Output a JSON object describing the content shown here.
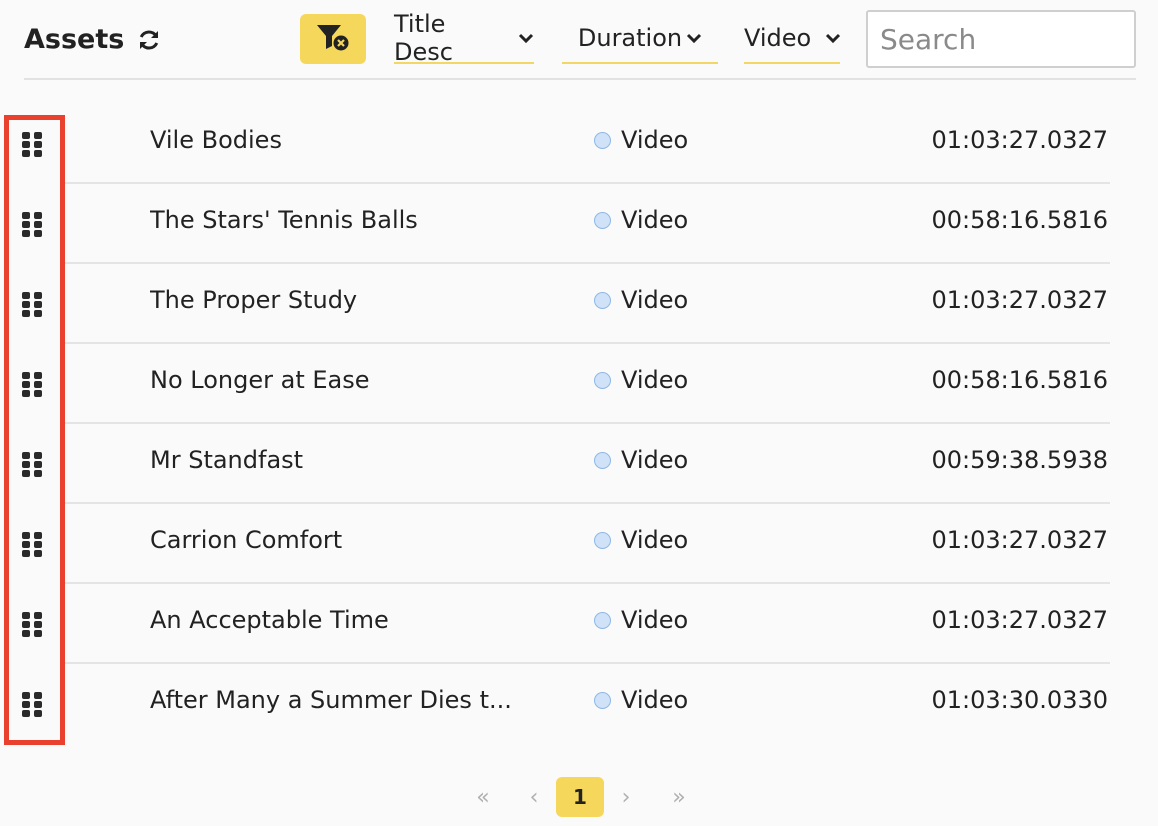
{
  "header": {
    "title": "Assets",
    "sort_label": "Title Desc",
    "duration_label": "Duration",
    "type_label": "Video",
    "search_placeholder": "Search",
    "icons": {
      "refresh": "refresh-icon",
      "filter_clear": "filter-clear-icon",
      "chevron": "chevron-down-icon"
    }
  },
  "rows": [
    {
      "title": "Vile Bodies",
      "type": "Video",
      "duration": "01:03:27.0327"
    },
    {
      "title": "The Stars' Tennis Balls",
      "type": "Video",
      "duration": "00:58:16.5816"
    },
    {
      "title": "The Proper Study",
      "type": "Video",
      "duration": "01:03:27.0327"
    },
    {
      "title": "No Longer at Ease",
      "type": "Video",
      "duration": "00:58:16.5816"
    },
    {
      "title": "Mr Standfast",
      "type": "Video",
      "duration": "00:59:38.5938"
    },
    {
      "title": "Carrion Comfort",
      "type": "Video",
      "duration": "01:03:27.0327"
    },
    {
      "title": "An Acceptable Time",
      "type": "Video",
      "duration": "01:03:27.0327"
    },
    {
      "title": "After Many a Summer Dies t...",
      "type": "Video",
      "duration": "01:03:30.0330"
    }
  ],
  "pagination": {
    "first": "«",
    "prev": "‹",
    "current": "1",
    "next": "›",
    "last": "»"
  },
  "colors": {
    "accent": "#f5d75b",
    "highlight": "#e9412e",
    "type_dot": "#cfe2f8"
  }
}
